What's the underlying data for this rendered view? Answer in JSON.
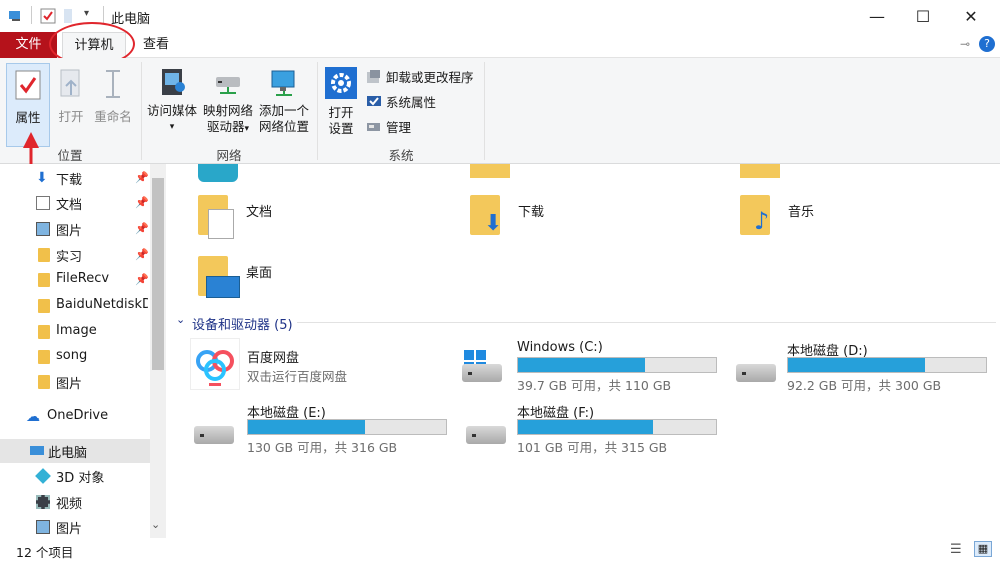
{
  "window": {
    "title": "此电脑",
    "minimize": "—",
    "maximize": "☐",
    "close": "✕"
  },
  "tabs": {
    "file": "文件",
    "computer": "计算机",
    "view": "查看"
  },
  "ribbon": {
    "location": {
      "properties": "属性",
      "open": "打开",
      "rename": "重命名",
      "label": "位置"
    },
    "network": {
      "media_line1": "访问媒体",
      "map_line1": "映射网络",
      "map_line2": "驱动器",
      "add_line1": "添加一个",
      "add_line2": "网络位置",
      "label": "网络"
    },
    "system": {
      "settings_line1": "打开",
      "settings_line2": "设置",
      "uninstall": "卸载或更改程序",
      "sysprops": "系统属性",
      "manage": "管理",
      "label": "系统"
    }
  },
  "nav": {
    "items": [
      {
        "label": "下载"
      },
      {
        "label": "文档"
      },
      {
        "label": "图片"
      },
      {
        "label": "实习"
      },
      {
        "label": "FileRecv"
      },
      {
        "label": "BaiduNetdiskDownload"
      },
      {
        "label": "Image"
      },
      {
        "label": "song"
      },
      {
        "label": "图片"
      },
      {
        "label": "OneDrive"
      },
      {
        "label": "此电脑"
      },
      {
        "label": "3D 对象"
      },
      {
        "label": "视频"
      },
      {
        "label": "图片"
      }
    ]
  },
  "folders": {
    "documents": "文档",
    "downloads": "下载",
    "music": "音乐",
    "desktop": "桌面"
  },
  "devices": {
    "header": "设备和驱动器 (5)",
    "baidu_name": "百度网盘",
    "baidu_sub": "双击运行百度网盘",
    "drives": [
      {
        "name": "Windows (C:)",
        "info": "39.7 GB 可用，共 110 GB",
        "used_fraction": 0.64
      },
      {
        "name": "本地磁盘 (D:)",
        "info": "92.2 GB 可用，共 300 GB",
        "used_fraction": 0.69
      },
      {
        "name": "本地磁盘 (E:)",
        "info": "130 GB 可用，共 316 GB",
        "used_fraction": 0.59
      },
      {
        "name": "本地磁盘 (F:)",
        "info": "101 GB 可用，共 315 GB",
        "used_fraction": 0.68
      }
    ]
  },
  "status": {
    "count": "12 个项目"
  },
  "colors": {
    "file_tab": "#b5121b",
    "bar_fill": "#26a0da",
    "annotation": "#e0262d",
    "folder": "#f3c85b"
  }
}
